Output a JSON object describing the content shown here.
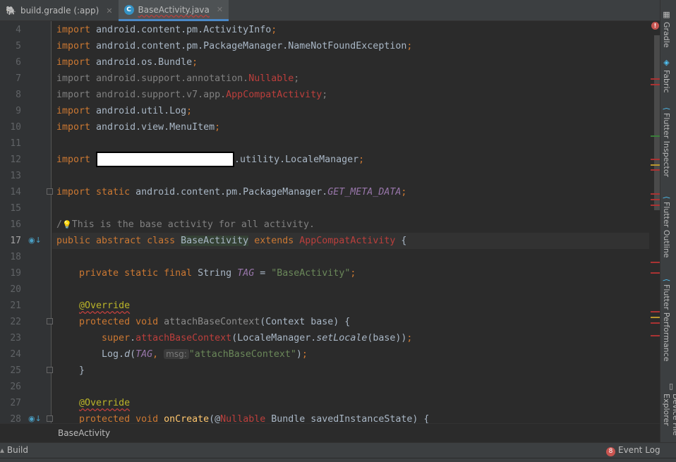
{
  "tabs": [
    {
      "label": "build.gradle (:app)",
      "icon": "gradle-elephant-icon",
      "active": false
    },
    {
      "label": "BaseActivity.java",
      "icon": "java-class-icon",
      "active": true
    }
  ],
  "editor": {
    "current_line": 17,
    "lines": [
      {
        "n": 4,
        "t": [
          [
            "import ",
            "kw"
          ],
          [
            "android.content.pm.ActivityInfo",
            ""
          ],
          [
            ";",
            "kw"
          ]
        ]
      },
      {
        "n": 5,
        "t": [
          [
            "import ",
            "kw"
          ],
          [
            "android.content.pm.PackageManager.NameNotFoundException",
            ""
          ],
          [
            ";",
            "kw"
          ]
        ]
      },
      {
        "n": 6,
        "t": [
          [
            "import ",
            "kw"
          ],
          [
            "android.os.Bundle",
            ""
          ],
          [
            ";",
            "kw"
          ]
        ]
      },
      {
        "n": 7,
        "t": [
          [
            "import android.support.annotation.",
            "gray"
          ],
          [
            "Nullable",
            "err"
          ],
          [
            ";",
            "gray"
          ]
        ]
      },
      {
        "n": 8,
        "t": [
          [
            "import android.support.v7.app.",
            "gray"
          ],
          [
            "AppCompatActivity",
            "err"
          ],
          [
            ";",
            "gray"
          ]
        ]
      },
      {
        "n": 9,
        "t": [
          [
            "import ",
            "kw"
          ],
          [
            "android.util.Log",
            ""
          ],
          [
            ";",
            "kw"
          ]
        ]
      },
      {
        "n": 10,
        "t": [
          [
            "import ",
            "kw"
          ],
          [
            "android.view.MenuItem",
            ""
          ],
          [
            ";",
            "kw"
          ]
        ]
      },
      {
        "n": 11,
        "t": []
      },
      {
        "n": 12,
        "t": [
          [
            "import ",
            "kw"
          ],
          [
            "",
            "redact"
          ],
          [
            ".utility.LocaleManager",
            ""
          ],
          [
            ";",
            "kw"
          ]
        ]
      },
      {
        "n": 13,
        "t": []
      },
      {
        "n": 14,
        "t": [
          [
            "import static ",
            "kw"
          ],
          [
            "android.content.pm.PackageManager.",
            ""
          ],
          [
            "GET_META_DATA",
            "fld"
          ],
          [
            ";",
            "kw"
          ]
        ]
      },
      {
        "n": 15,
        "t": []
      },
      {
        "n": 16,
        "t": [
          [
            "/",
            "cm"
          ],
          [
            "",
            "bulb"
          ],
          [
            "This is the base activity for all activity.",
            "cm"
          ]
        ]
      },
      {
        "n": 17,
        "t": [
          [
            "public abstract class ",
            "kw"
          ],
          [
            "BaseActivity",
            "hl"
          ],
          [
            " extends ",
            "kw"
          ],
          [
            "AppCompatActivity",
            "err"
          ],
          [
            " {",
            ""
          ]
        ]
      },
      {
        "n": 18,
        "t": []
      },
      {
        "n": 19,
        "t": [
          [
            "    private static final ",
            "kw"
          ],
          [
            "String ",
            ""
          ],
          [
            "TAG",
            "fld"
          ],
          [
            " = ",
            ""
          ],
          [
            "\"BaseActivity\"",
            "st"
          ],
          [
            ";",
            "kw"
          ]
        ]
      },
      {
        "n": 20,
        "t": []
      },
      {
        "n": 21,
        "t": [
          [
            "    ",
            ""
          ],
          [
            "@Override",
            "ann"
          ]
        ]
      },
      {
        "n": 22,
        "t": [
          [
            "    protected void ",
            "kw"
          ],
          [
            "attachBaseContext",
            "dim"
          ],
          [
            "(Context base) {",
            ""
          ]
        ]
      },
      {
        "n": 23,
        "t": [
          [
            "        super",
            "kw"
          ],
          [
            ".",
            ""
          ],
          [
            "attachBaseContext",
            "err"
          ],
          [
            "(LocaleManager.",
            ""
          ],
          [
            "setLocale",
            "it"
          ],
          [
            "(base))",
            ""
          ],
          [
            ";",
            "kw"
          ]
        ]
      },
      {
        "n": 24,
        "t": [
          [
            "        Log.",
            ""
          ],
          [
            "d",
            "it"
          ],
          [
            "(",
            ""
          ],
          [
            "TAG",
            "fld"
          ],
          [
            ", ",
            "kw"
          ],
          [
            "msg:",
            "hint"
          ],
          [
            "\"attachBaseContext\"",
            "st"
          ],
          [
            ")",
            ""
          ],
          [
            ";",
            "kw"
          ]
        ]
      },
      {
        "n": 25,
        "t": [
          [
            "    }",
            ""
          ]
        ]
      },
      {
        "n": 26,
        "t": []
      },
      {
        "n": 27,
        "t": [
          [
            "    ",
            ""
          ],
          [
            "@Override",
            "ann"
          ]
        ]
      },
      {
        "n": 28,
        "t": [
          [
            "    protected void ",
            "kw"
          ],
          [
            "onCreate",
            "meth"
          ],
          [
            "(@",
            ""
          ],
          [
            "Nullable",
            "err"
          ],
          [
            " Bundle savedInstanceState) {",
            ""
          ]
        ]
      }
    ]
  },
  "right_tools": [
    {
      "label": "Gradle",
      "icon": "gradle-icon"
    },
    {
      "label": "Fabric",
      "icon": "fabric-icon"
    },
    {
      "label": "Flutter Inspector",
      "icon": "flutter-icon"
    },
    {
      "label": "Flutter Outline",
      "icon": "flutter-icon"
    },
    {
      "label": "Flutter Performance",
      "icon": "flutter-icon"
    },
    {
      "label": "Device File Explorer",
      "icon": "device-icon"
    }
  ],
  "breadcrumb": "BaseActivity",
  "bottom": {
    "build_label": "Build",
    "event_log_label": "Event Log",
    "event_count": "8"
  },
  "colors": {
    "keyword": "#cc7832",
    "string": "#6a8759",
    "error": "#bc3f3c",
    "field": "#9876aa",
    "accent": "#4a88c7"
  }
}
